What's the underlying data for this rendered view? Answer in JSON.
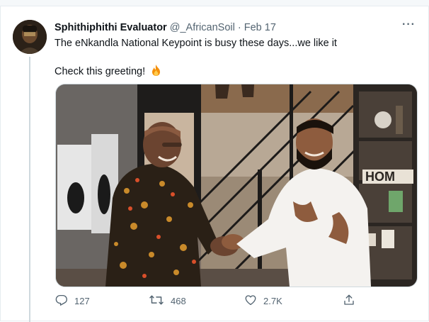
{
  "tweet": {
    "display_name": "Sphithiphithi Evaluator",
    "handle": "@_AfricanSoil",
    "separator": "·",
    "date": "Feb 17",
    "more": "···",
    "line1": "The eNkandla National Keypoint is busy these days...we like it",
    "line2": "Check this greeting!",
    "emoji_icon": "fire-icon",
    "photo_sign_text": "HOM"
  },
  "actions": {
    "reply_count": "127",
    "retweet_count": "468",
    "like_count": "2.7K"
  },
  "colors": {
    "text": "#0f1419",
    "muted": "#536471",
    "border": "#cfd9de"
  }
}
